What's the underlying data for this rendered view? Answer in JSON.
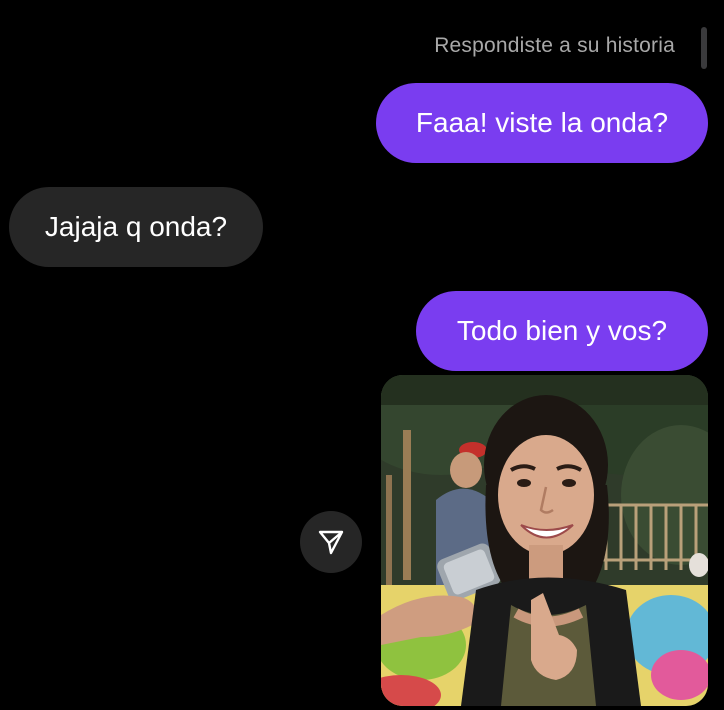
{
  "chat": {
    "reply_note": "Respondiste a su historia",
    "messages": [
      {
        "direction": "sent",
        "text": "Faaa! viste la onda?"
      },
      {
        "direction": "received",
        "text": "Jajaja q onda?"
      },
      {
        "direction": "sent",
        "text": "Todo bien y vos?"
      }
    ],
    "photo_message": {
      "direction": "sent",
      "content": "photo"
    },
    "share_icon": "paper-plane-icon"
  },
  "colors": {
    "background": "#000000",
    "sent_bubble": "#7a3df0",
    "received_bubble": "#262626",
    "reply_note_text": "#a8a8a8",
    "share_button": "#262626"
  }
}
